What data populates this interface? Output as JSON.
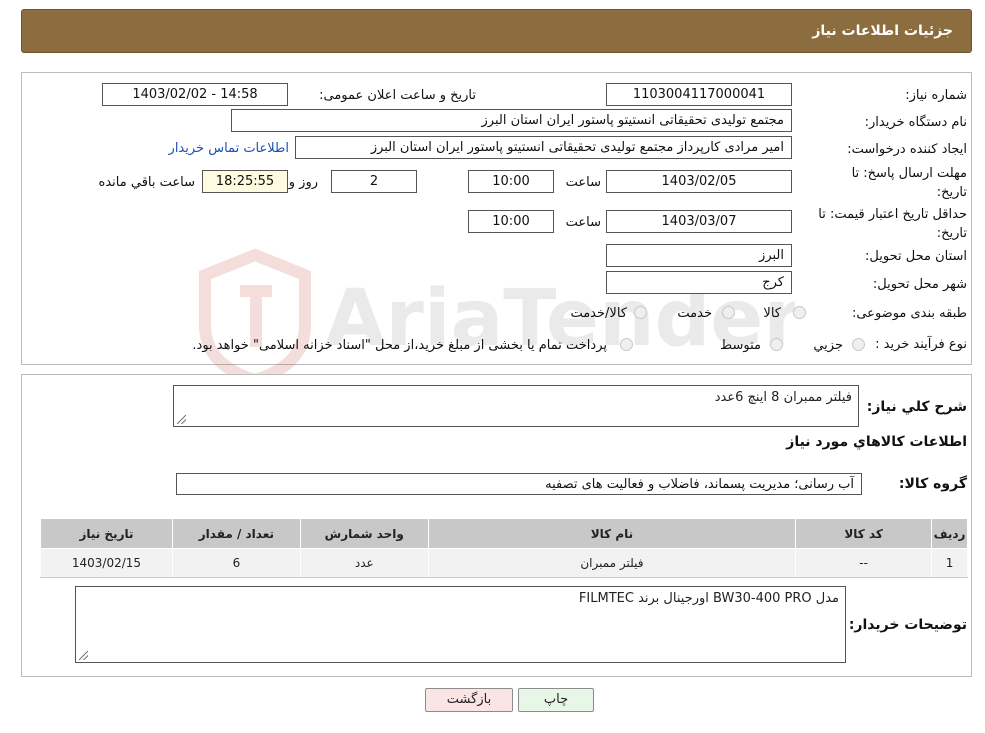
{
  "header": {
    "title": "جزئیات اطلاعات نیاز"
  },
  "form": {
    "need_number": {
      "label": "شماره نیاز:",
      "value": "1103004117000041"
    },
    "announce_datetime": {
      "label": "تاریخ و ساعت اعلان عمومی:",
      "value": "1403/02/02 - 14:58"
    },
    "buyer_org": {
      "label": "نام دستگاه خریدار:",
      "value": "مجتمع تولیدی تحقیقاتی انستیتو پاستور ایران استان البرز"
    },
    "requester": {
      "label": "ایجاد کننده درخواست:",
      "value": "امیر مرادی کارپرداز مجتمع تولیدی تحقیقاتی انستیتو پاستور ایران استان البرز",
      "contact_link": "اطلاعات تماس خریدار"
    },
    "deadline": {
      "label": "مهلت ارسال پاسخ: تا تاریخ:",
      "date": "1403/02/05",
      "time_label": "ساعت",
      "time": "10:00",
      "days": "2",
      "days_label": "روز و",
      "remaining": "18:25:55",
      "remaining_label": "ساعت باقي مانده"
    },
    "validity": {
      "label": "حداقل تاریخ اعتبار قیمت: تا تاریخ:",
      "date": "1403/03/07",
      "time_label": "ساعت",
      "time": "10:00"
    },
    "province": {
      "label": "استان محل تحویل:",
      "value": "البرز"
    },
    "city": {
      "label": "شهر محل تحویل:",
      "value": "کرج"
    },
    "category": {
      "label": "طبقه بندی موضوعی:",
      "options": [
        "کالا",
        "خدمت",
        "کالا/خدمت"
      ]
    },
    "purchase_type": {
      "label": "نوع فرآیند خرید :",
      "options": [
        "جزيي",
        "متوسط"
      ],
      "note": "پرداخت تمام یا بخشی از مبلغ خرید،از محل \"اسناد خزانه اسلامی\" خواهد بود."
    }
  },
  "details": {
    "summary": {
      "label": "شرح کلي نياز:",
      "value": "فیلتر ممبران 8 اینچ   6عدد"
    },
    "items_title": "اطلاعات کالاهاي مورد نياز",
    "group": {
      "label": "گروه کالا:",
      "value": "آب رسانی؛ مدیریت پسماند، فاضلاب و فعالیت های تصفیه"
    },
    "table": {
      "headers": [
        "رديف",
        "کد کالا",
        "نام کالا",
        "واحد شمارش",
        "تعداد / مقدار",
        "تاريخ نياز"
      ],
      "rows": [
        [
          "1",
          "--",
          "فیلتر ممبران",
          "عدد",
          "6",
          "1403/02/15"
        ]
      ]
    },
    "buyer_notes": {
      "label": "توضیحات خریدار:",
      "value": "مدل BW30-400 PRO اورجینال برند FILMTEC"
    }
  },
  "buttons": {
    "print": "چاپ",
    "back": "بازگشت"
  },
  "watermark": {
    "text": "AriaTender.neT"
  },
  "colors": {
    "header_bg": "#8b6d3f",
    "link": "#1f4fb5",
    "table_header": "#c8c8c8"
  }
}
